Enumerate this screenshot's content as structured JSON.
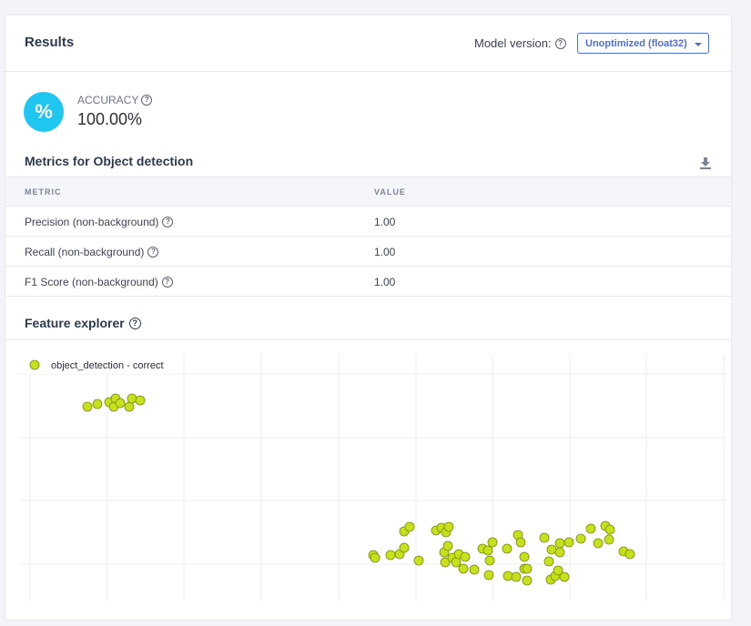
{
  "header": {
    "title": "Results",
    "model_version_label": "Model version:",
    "model_version_value": "Unoptimized (float32)"
  },
  "accuracy": {
    "label": "ACCURACY",
    "value": "100.00%",
    "icon_glyph": "%",
    "icon_color": "#1ec6f0"
  },
  "metrics": {
    "title": "Metrics for Object detection",
    "columns": [
      "METRIC",
      "VALUE"
    ],
    "rows": [
      {
        "metric": "Precision (non-background)",
        "value": "1.00"
      },
      {
        "metric": "Recall (non-background)",
        "value": "1.00"
      },
      {
        "metric": "F1 Score (non-background)",
        "value": "1.00"
      }
    ]
  },
  "feature_explorer": {
    "title": "Feature explorer",
    "legend": "object_detection - correct",
    "point_color": "#c6e01a"
  },
  "chart_data": {
    "type": "scatter",
    "series": [
      {
        "name": "object_detection - correct",
        "points": [
          [
            95,
            446
          ],
          [
            106,
            443
          ],
          [
            119,
            441
          ],
          [
            124,
            446
          ],
          [
            126,
            437
          ],
          [
            131,
            442
          ],
          [
            141,
            446
          ],
          [
            144,
            437
          ],
          [
            153,
            439
          ],
          [
            409,
            609
          ],
          [
            411,
            612
          ],
          [
            428,
            609
          ],
          [
            438,
            608
          ],
          [
            443,
            583
          ],
          [
            443,
            601
          ],
          [
            449,
            578
          ],
          [
            459,
            615
          ],
          [
            478,
            582
          ],
          [
            484,
            579
          ],
          [
            487,
            606
          ],
          [
            488,
            617
          ],
          [
            489,
            584
          ],
          [
            491,
            599
          ],
          [
            492,
            578
          ],
          [
            496,
            612
          ],
          [
            500,
            617
          ],
          [
            503,
            608
          ],
          [
            508,
            624
          ],
          [
            510,
            611
          ],
          [
            520,
            625
          ],
          [
            529,
            602
          ],
          [
            535,
            604
          ],
          [
            536,
            631
          ],
          [
            537,
            615
          ],
          [
            540,
            595
          ],
          [
            556,
            602
          ],
          [
            557,
            632
          ],
          [
            566,
            633
          ],
          [
            568,
            587
          ],
          [
            571,
            595
          ],
          [
            575,
            611
          ],
          [
            575,
            624
          ],
          [
            578,
            624
          ],
          [
            578,
            637
          ],
          [
            597,
            590
          ],
          [
            602,
            616
          ],
          [
            604,
            636
          ],
          [
            605,
            603
          ],
          [
            609,
            632
          ],
          [
            612,
            626
          ],
          [
            614,
            596
          ],
          [
            614,
            606
          ],
          [
            619,
            633
          ],
          [
            624,
            595
          ],
          [
            637,
            591
          ],
          [
            648,
            580
          ],
          [
            656,
            596
          ],
          [
            664,
            577
          ],
          [
            668,
            592
          ],
          [
            669,
            581
          ],
          [
            684,
            605
          ],
          [
            691,
            608
          ]
        ]
      }
    ]
  }
}
